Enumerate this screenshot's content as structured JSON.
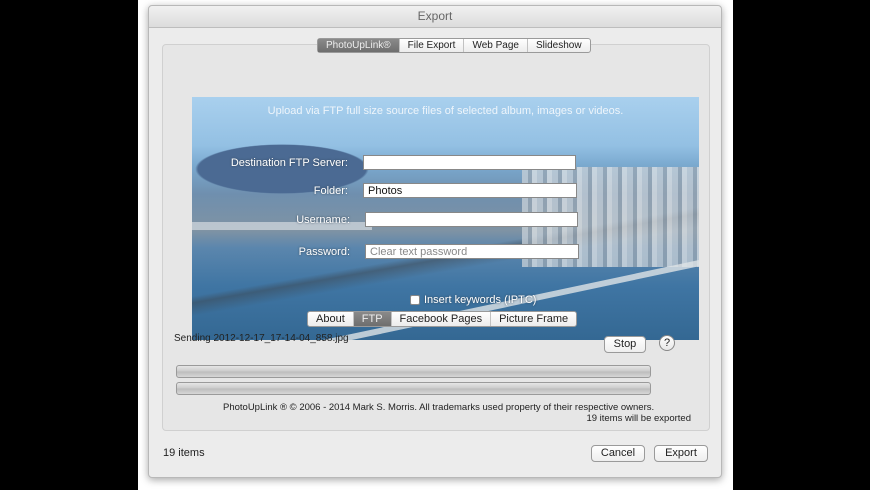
{
  "window": {
    "title": "Export"
  },
  "top_tabs": [
    {
      "label": "PhotoUpLink®",
      "active": true
    },
    {
      "label": "File Export"
    },
    {
      "label": "Web Page"
    },
    {
      "label": "Slideshow"
    }
  ],
  "panel": {
    "heading": "Upload via FTP full size source files of selected album, images or videos.",
    "fields": {
      "server_label": "Destination FTP Server:",
      "server_value": "",
      "folder_label": "Folder:",
      "folder_value": "Photos",
      "username_label": "Username:",
      "username_value": "",
      "password_label": "Password:",
      "password_placeholder": "Clear text password"
    },
    "insert_keywords": {
      "label": "Insert keywords (IPTC)",
      "checked": false
    }
  },
  "sub_tabs": [
    {
      "label": "About"
    },
    {
      "label": "FTP",
      "active": true
    },
    {
      "label": "Facebook Pages"
    },
    {
      "label": "Picture Frame"
    }
  ],
  "status": {
    "sending": "Sending 2012-12-17_17-14-04_858.jpg",
    "stop_label": "Stop",
    "help_label": "?",
    "progress1": 0,
    "progress2": 0,
    "copyright": "PhotoUpLink ® © 2006 - 2014 Mark S. Morris. All trademarks used property of their respective owners.",
    "export_count": "19 items will be exported"
  },
  "footer": {
    "items": "19 items",
    "cancel_label": "Cancel",
    "export_label": "Export"
  }
}
